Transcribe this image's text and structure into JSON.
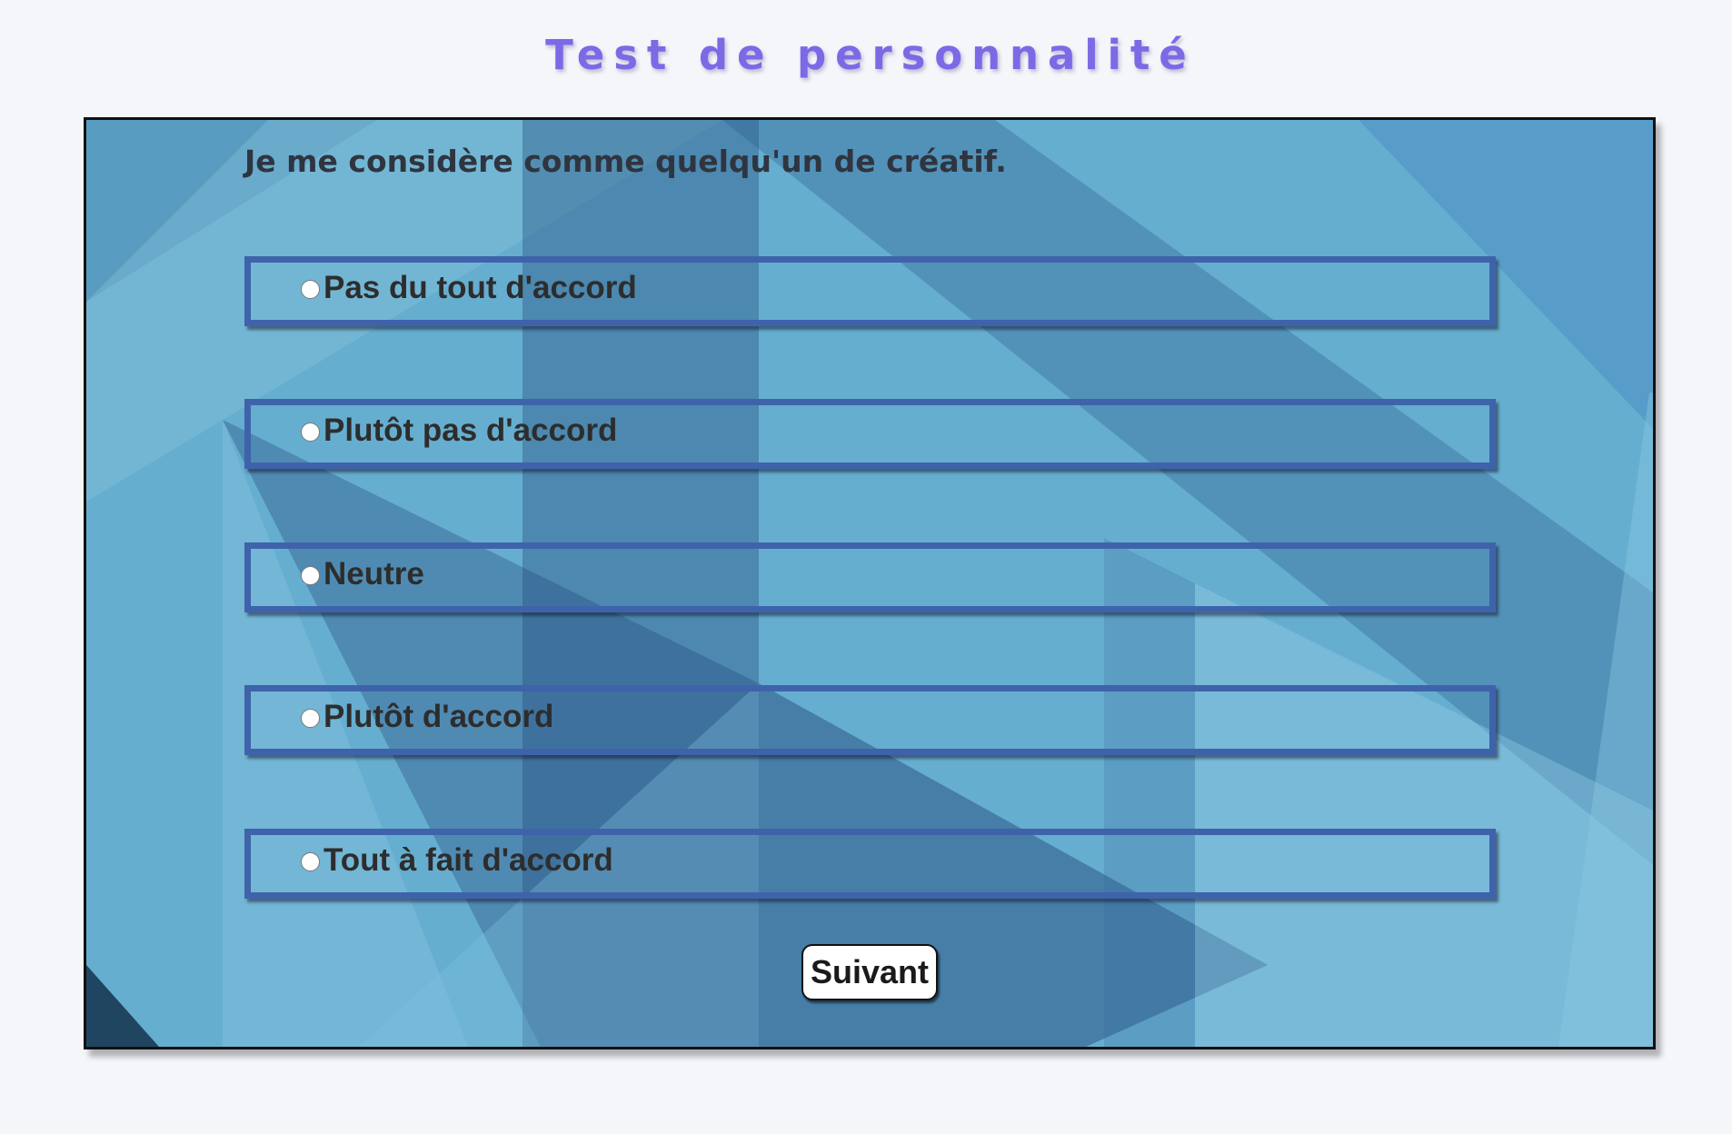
{
  "page": {
    "title": "Test de personnalité"
  },
  "quiz": {
    "question": "Je me considère comme quelqu'un de créatif.",
    "options": [
      {
        "label": "Pas du tout d'accord",
        "selected": false
      },
      {
        "label": "Plutôt pas d'accord",
        "selected": false
      },
      {
        "label": "Neutre",
        "selected": false
      },
      {
        "label": "Plutôt d'accord",
        "selected": false
      },
      {
        "label": "Tout à fait d'accord",
        "selected": false
      }
    ],
    "next_label": "Suivant"
  },
  "colors": {
    "title": "#7b6ae6",
    "option_border": "#3f63aa",
    "card_background": "#6fb6d4",
    "page_background": "#f5f6fa"
  }
}
